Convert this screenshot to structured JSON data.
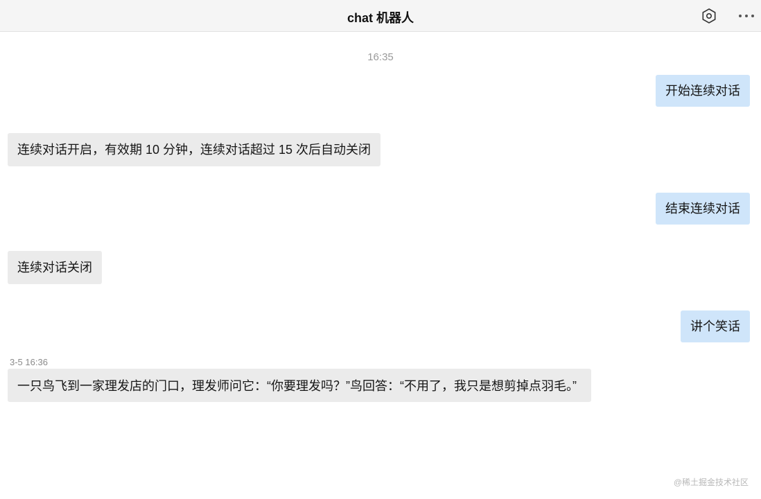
{
  "header": {
    "title": "chat 机器人",
    "settings_icon": "hexagon-settings-icon",
    "more_icon": "more-horizontal-icon"
  },
  "messages": {
    "top_timestamp": "16:35",
    "items": [
      {
        "role": "user",
        "text": "开始连续对话"
      },
      {
        "role": "bot",
        "text": "连续对话开启，有效期 10 分钟，连续对话超过 15 次后自动关闭"
      },
      {
        "role": "user",
        "text": "结束连续对话"
      },
      {
        "role": "bot",
        "text": "连续对话关闭"
      },
      {
        "role": "user",
        "text": "讲个笑话"
      },
      {
        "role": "bot",
        "text": "一只鸟飞到一家理发店的门口，理发师问它：“你要理发吗？”鸟回答：“不用了，我只是想剪掉点羽毛。”"
      }
    ],
    "second_timestamp": "3-5 16:36"
  },
  "watermark": "@稀土掘金技术社区",
  "colors": {
    "header_bg": "#f5f5f5",
    "user_bubble": "#cfe5fa",
    "bot_bubble": "#ebebeb"
  }
}
